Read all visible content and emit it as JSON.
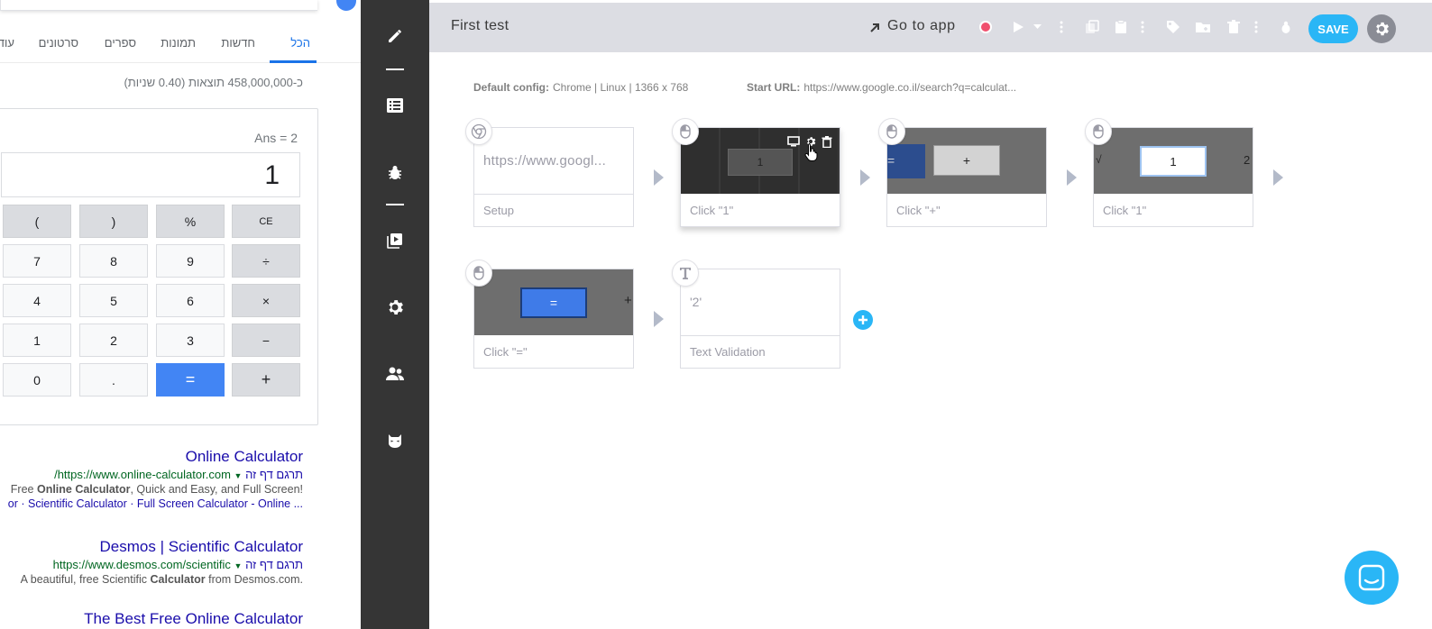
{
  "google": {
    "tabs": [
      {
        "label": "הכל",
        "active": true
      },
      {
        "label": "חדשות",
        "active": false
      },
      {
        "label": "תמונות",
        "active": false
      },
      {
        "label": "ספרים",
        "active": false
      },
      {
        "label": "סרטונים",
        "active": false
      },
      {
        "label": "עוד",
        "active": false
      }
    ],
    "results_count": "כ-458,000,000 תוצאות (0.40 שניות)",
    "calculator": {
      "ans": "Ans = 2",
      "display": "1",
      "keys": [
        [
          "(",
          ")",
          "%",
          "CE"
        ],
        [
          "7",
          "8",
          "9",
          "÷"
        ],
        [
          "4",
          "5",
          "6",
          "×"
        ],
        [
          "1",
          "2",
          "3",
          "−"
        ],
        [
          "0",
          ".",
          "=",
          "+"
        ]
      ]
    },
    "results": [
      {
        "title": "Online Calculator",
        "url": "https://www.online-calculator.com/",
        "translate": "תרגם דף זה",
        "desc_pre": "Free ",
        "desc_bold": "Online Calculator",
        "desc_post": ", Quick and Easy, and Full Screen!",
        "links": "or · Scientific Calculator · Full Screen Calculator - Online ..."
      },
      {
        "title": "Desmos | Scientific Calculator",
        "url": "https://www.desmos.com/scientific",
        "translate": "תרגם דף זה",
        "desc_pre": "A beautiful, free Scientific ",
        "desc_bold": "Calculator",
        "desc_post": " from Desmos.com."
      },
      {
        "title": "The Best Free Online Calculator"
      }
    ]
  },
  "app": {
    "test_title": "First test",
    "go_to_app": "Go to app",
    "save_label": "SAVE",
    "config": {
      "default_label": "Default config:",
      "default_value": "Chrome | Linux | 1366 x 768",
      "start_label": "Start URL:",
      "start_value": "https://www.google.co.il/search?q=calculat..."
    },
    "steps": [
      {
        "label": "Setup",
        "content": "https://www.googl...",
        "type": "setup"
      },
      {
        "label": "Click \"1\"",
        "thumb_text": "1",
        "type": "click"
      },
      {
        "label": "Click \"+\"",
        "thumb_text": "+",
        "type": "click"
      },
      {
        "label": "Click \"1\"",
        "thumb_text": "1",
        "type": "click"
      },
      {
        "label": "Click \"=\"",
        "thumb_text": "=",
        "type": "click"
      },
      {
        "label": "Text Validation",
        "content": "'2'",
        "type": "validation"
      }
    ],
    "colors": {
      "accent": "#2ab6f6",
      "sidebar": "#353535",
      "header": "#dcdde3",
      "record": "#f0506e"
    }
  }
}
